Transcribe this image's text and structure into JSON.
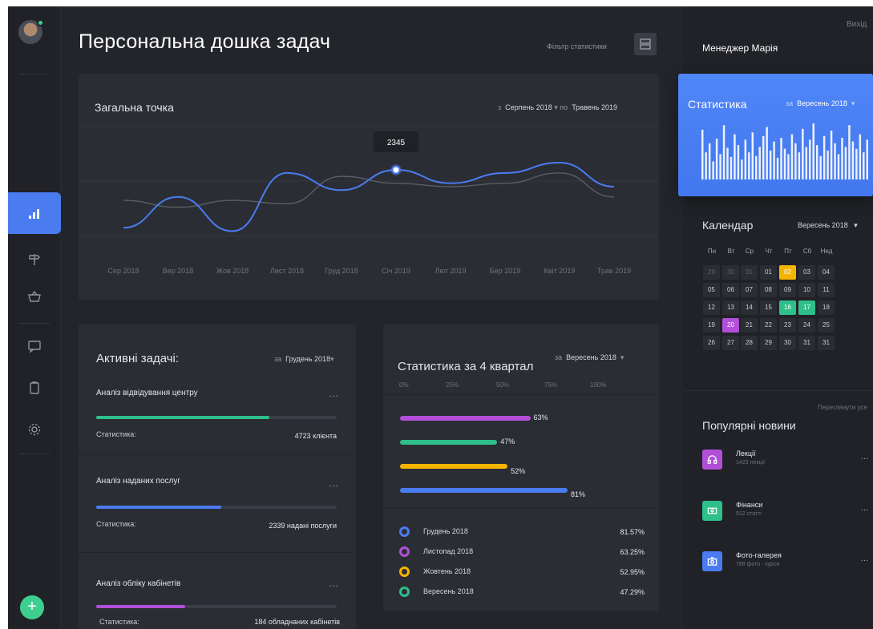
{
  "header": {
    "title": "Персональна дошка задач",
    "filter_label": "Фільтр статистики",
    "logout_label": "Вихід",
    "user_name": "Менеджер Марія"
  },
  "sidebar": {
    "items": [
      {
        "icon": "bar-chart-icon",
        "active": true
      },
      {
        "icon": "signpost-icon",
        "active": false
      },
      {
        "icon": "basket-icon",
        "active": false
      },
      {
        "icon": "chat-icon",
        "active": false
      },
      {
        "icon": "clipboard-icon",
        "active": false
      },
      {
        "icon": "gear-icon",
        "active": false
      }
    ],
    "add_label": "+"
  },
  "overview": {
    "title": "Загальна точка",
    "range_from_prefix": "з",
    "range_from": "Серпень 2018",
    "range_to_prefix": "по",
    "range_to": "Травень 2019",
    "tooltip_value": "2345",
    "x_labels": [
      "Сер 2018",
      "Вер 2018",
      "Жов 2018",
      "Лист 2018",
      "Груд 2018",
      "Січ 2019",
      "Лют 2019",
      "Бер 2019",
      "Квіт 2019",
      "Трав 2019"
    ]
  },
  "tasks": {
    "title": "Активні задачі:",
    "period_prefix": "за",
    "period": "Грудень 2018",
    "more_label": "...",
    "items": [
      {
        "name": "Аналіз відвідування центру",
        "stat_label": "Статистика:",
        "stat_value": "4723 клієнта",
        "progress": 0.72,
        "color": "#2fbf8a"
      },
      {
        "name": "Аналіз наданих послуг",
        "stat_label": "Статистика:",
        "stat_value": "2339 надані послуги",
        "progress": 0.52,
        "color": "#4a7cf0"
      },
      {
        "name": "Аналіз обліку кабінетів",
        "stat_label": "Статистика:",
        "stat_value": "184 обладнаних кабінетів",
        "progress": 0.37,
        "color": "#b14fd8"
      }
    ]
  },
  "quarter": {
    "title": "Статистика за 4 квартал",
    "period_prefix": "за",
    "period": "Вересень 2018",
    "scale": [
      "0%",
      "25%",
      "50%",
      "75%",
      "100%"
    ],
    "bars": [
      {
        "pct": "63%",
        "value": 63,
        "color": "#b14fd8"
      },
      {
        "pct": "47%",
        "value": 47,
        "color": "#2fbf8a"
      },
      {
        "pct": "52%",
        "value": 52,
        "color": "#f5b400"
      },
      {
        "pct": "81%",
        "value": 81,
        "color": "#4a7cf0"
      }
    ],
    "legend": [
      {
        "label": "Грудень 2018",
        "value": "81.57%",
        "color": "#4a7cf0"
      },
      {
        "label": "Листопад 2018",
        "value": "63.25%",
        "color": "#b14fd8"
      },
      {
        "label": "Жовтень 2018",
        "value": "52.95%",
        "color": "#f5b400"
      },
      {
        "label": "Вересень 2018",
        "value": "47.29%",
        "color": "#2fbf8a"
      }
    ]
  },
  "stats": {
    "title": "Статистика",
    "period_prefix": "за",
    "period": "Вересень 2018"
  },
  "calendar": {
    "title": "Календар",
    "period": "Вересень 2018",
    "weekdays": [
      "Пн",
      "Вт",
      "Ср",
      "Чт",
      "Пт",
      "Сб",
      "Нед"
    ],
    "days": [
      [
        "29",
        "30",
        "31",
        "01",
        "02",
        "03",
        "04"
      ],
      [
        "05",
        "06",
        "07",
        "08",
        "09",
        "10",
        "11"
      ],
      [
        "12",
        "13",
        "14",
        "15",
        "16",
        "17",
        "18"
      ],
      [
        "19",
        "20",
        "21",
        "22",
        "23",
        "24",
        "25"
      ],
      [
        "26",
        "27",
        "28",
        "29",
        "30",
        "31",
        "31"
      ]
    ],
    "highlights": {
      "02": "orange",
      "16": "green",
      "17": "green",
      "20": "purple"
    }
  },
  "news": {
    "see_all_label": "Переглянути усе",
    "title": "Популярні новини",
    "more_label": "...",
    "items": [
      {
        "name": "Лекції",
        "sub": "1423 лекції",
        "icon": "headphones-icon",
        "color": "#b14fd8"
      },
      {
        "name": "Фінанси",
        "sub": "512 статті",
        "icon": "money-icon",
        "color": "#2fbf8a"
      },
      {
        "name": "Фото-галерея",
        "sub": "788 фото · курси",
        "icon": "camera-icon",
        "color": "#4a7cf0"
      }
    ]
  },
  "chart_data": [
    {
      "type": "line",
      "title": "Загальна точка",
      "categories": [
        "Сер 2018",
        "Вер 2018",
        "Жов 2018",
        "Лист 2018",
        "Груд 2018",
        "Січ 2019",
        "Лют 2019",
        "Бер 2019",
        "Квіт 2019",
        "Трав 2019"
      ],
      "series": [
        {
          "values": [
            1500,
            1950,
            1450,
            2300,
            2050,
            2345,
            2150,
            2300,
            2450,
            2100
          ],
          "color": "#4a7cf0"
        },
        {
          "values": [
            1900,
            1800,
            1900,
            1850,
            2250,
            2150,
            2100,
            2150,
            2300,
            1950
          ],
          "color": "#5b5e66"
        }
      ],
      "annotation": "2345",
      "ylim": [
        1000,
        3000
      ],
      "grid": true
    },
    {
      "type": "bar",
      "title": "Статистика",
      "values": [
        55,
        30,
        40,
        20,
        45,
        28,
        60,
        35,
        25,
        50,
        38,
        22,
        44,
        30,
        52,
        26,
        36,
        48,
        58,
        32,
        42,
        24,
        46,
        34,
        28,
        50,
        40,
        30,
        56,
        36,
        44,
        62,
        38,
        26,
        48,
        32,
        54,
        40,
        28,
        46,
        36,
        60,
        42,
        34,
        50,
        30,
        44
      ]
    }
  ]
}
